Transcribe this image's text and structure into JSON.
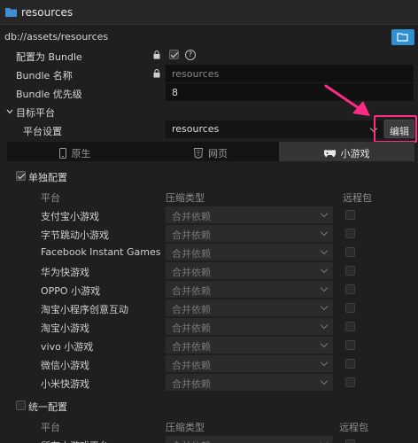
{
  "window": {
    "title": "resources"
  },
  "path": "db://assets/resources",
  "props": {
    "bundle_label": "配置为 Bundle",
    "bundle_name_label": "Bundle 名称",
    "bundle_name_value": "resources",
    "bundle_priority_label": "Bundle 优先级",
    "bundle_priority_value": "8",
    "help_glyph": "?"
  },
  "target": {
    "section_label": "目标平台",
    "platform_settings_label": "平台设置",
    "platform_select_value": "resources",
    "edit_button": "编辑"
  },
  "tabs": [
    {
      "label": "原生",
      "icon": "phone-icon"
    },
    {
      "label": "网页",
      "icon": "html5-icon"
    },
    {
      "label": "小游戏",
      "icon": "gamepad-icon",
      "active": true
    }
  ],
  "separate": {
    "label": "单独配置",
    "checked": true,
    "headers": {
      "platform": "平台",
      "compress": "压缩类型",
      "remote": "远程包"
    },
    "rows": [
      {
        "name": "支付宝小游戏",
        "compress": "合并依赖"
      },
      {
        "name": "字节跳动小游戏",
        "compress": "合并依赖"
      },
      {
        "name": "Facebook Instant Games",
        "compress": "合并依赖"
      },
      {
        "name": "华为快游戏",
        "compress": "合并依赖"
      },
      {
        "name": "OPPO 小游戏",
        "compress": "合并依赖"
      },
      {
        "name": "淘宝小程序创意互动",
        "compress": "合并依赖"
      },
      {
        "name": "淘宝小游戏",
        "compress": "合并依赖"
      },
      {
        "name": "vivo 小游戏",
        "compress": "合并依赖"
      },
      {
        "name": "微信小游戏",
        "compress": "合并依赖"
      },
      {
        "name": "小米快游戏",
        "compress": "合并依赖"
      }
    ]
  },
  "unified": {
    "label": "统一配置",
    "checked": false,
    "headers": {
      "platform": "平台",
      "compress": "压缩类型",
      "remote": "远程包"
    },
    "rows": [
      {
        "name": "所有小游戏平台",
        "compress": "合并依赖"
      }
    ]
  },
  "colors": {
    "accent": "#2e8fd1",
    "annotation": "#ff2b86"
  }
}
